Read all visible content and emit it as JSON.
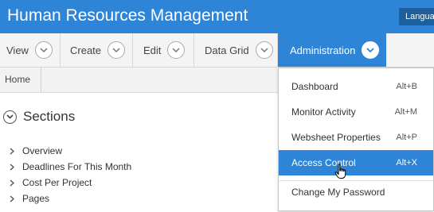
{
  "app": {
    "title": "Human Resources Management",
    "language_button": "Language"
  },
  "menu": {
    "items": [
      {
        "label": "View"
      },
      {
        "label": "Create"
      },
      {
        "label": "Edit"
      },
      {
        "label": "Data Grid"
      },
      {
        "label": "Administration",
        "active": true
      }
    ]
  },
  "breadcrumb": {
    "home": "Home"
  },
  "sections": {
    "title": "Sections",
    "items": [
      {
        "label": "Overview"
      },
      {
        "label": "Deadlines For This Month"
      },
      {
        "label": "Cost Per Project"
      },
      {
        "label": "Pages"
      }
    ]
  },
  "admin_menu": {
    "items": [
      {
        "label": "Dashboard",
        "accel": "Alt+B"
      },
      {
        "label": "Monitor Activity",
        "accel": "Alt+M"
      },
      {
        "label": "Websheet Properties",
        "accel": "Alt+P"
      },
      {
        "label": "Access Control",
        "accel": "Alt+X",
        "highlighted": true
      },
      {
        "label": "Change My Password",
        "accel": ""
      }
    ]
  },
  "colors": {
    "accent": "#2e84d6",
    "language_bg": "#1d5f9c"
  },
  "icons": {
    "menu_chevron": "chevron-down-icon",
    "tree_arrow": "chevron-right-icon",
    "cursor": "hand-pointer-icon"
  }
}
